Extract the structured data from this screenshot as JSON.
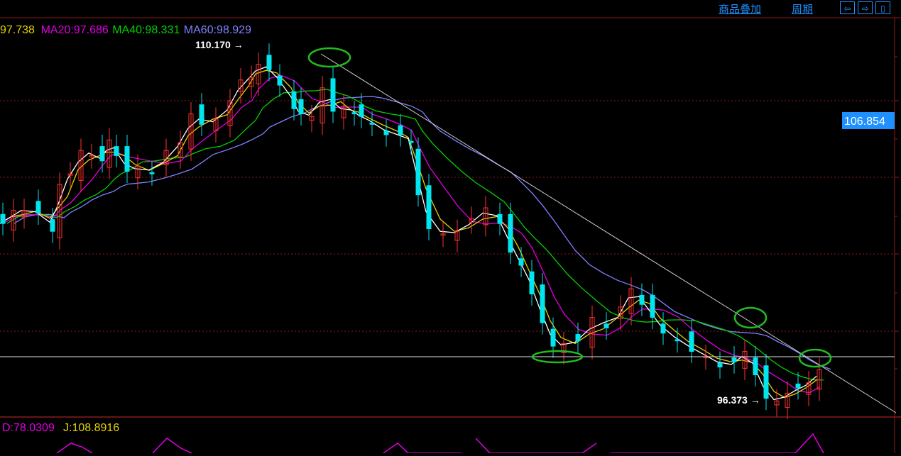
{
  "header": {
    "overlay_label": "商品叠加",
    "period_label": "周期",
    "nav_buttons": [
      "⇦",
      "⇨",
      "▯"
    ]
  },
  "ma_legend": [
    {
      "label": "97.738",
      "color": "#e6d200"
    },
    {
      "label": "MA20:97.686",
      "color": "#e000e0"
    },
    {
      "label": "MA40:98.331",
      "color": "#00d200"
    },
    {
      "label": "MA60:98.929",
      "color": "#8080ff"
    }
  ],
  "indicator_legend": [
    {
      "label": "D:78.0309",
      "color": "#e000e0"
    },
    {
      "label": "J:108.8916",
      "color": "#e6d200"
    }
  ],
  "price_tag": "106.854",
  "high_label": "110.170",
  "low_label": "96.373",
  "colors": {
    "up": "#ff3030",
    "down": "#00e5ee",
    "grid": "#8b1a1a",
    "ma_white": "#ffffff",
    "ma_yellow": "#e6d200",
    "ma_magenta": "#e000e0",
    "ma_green": "#00d200",
    "ma_purple": "#8080ff",
    "annotation": "#22bb22",
    "axis_tag_bg": "#1e90ff"
  },
  "chart_data": {
    "type": "candlestick",
    "grid": true,
    "annotations": [
      "support horizontal line",
      "descending trendline from 110.170 high",
      "4 green ellipse highlights"
    ],
    "points": [
      [
        0,
        103.4
      ],
      [
        15,
        103.9
      ],
      [
        30,
        103.9
      ],
      [
        50,
        103.8
      ],
      [
        70,
        103.1
      ],
      [
        80,
        104.9
      ],
      [
        95,
        105.3
      ],
      [
        110,
        106.2
      ],
      [
        125,
        106.0
      ],
      [
        140,
        105.8
      ],
      [
        150,
        106.6
      ],
      [
        160,
        106.0
      ],
      [
        175,
        105.4
      ],
      [
        190,
        105.6
      ],
      [
        210,
        105.3
      ],
      [
        230,
        106.2
      ],
      [
        250,
        106.5
      ],
      [
        265,
        107.6
      ],
      [
        280,
        107.2
      ],
      [
        300,
        107.4
      ],
      [
        320,
        108.1
      ],
      [
        335,
        108.9
      ],
      [
        350,
        109.0
      ],
      [
        360,
        109.5
      ],
      [
        375,
        109.3
      ],
      [
        390,
        108.7
      ],
      [
        410,
        107.8
      ],
      [
        420,
        107.6
      ],
      [
        435,
        107.5
      ],
      [
        450,
        108.6
      ],
      [
        465,
        107.7
      ],
      [
        480,
        107.9
      ],
      [
        495,
        107.6
      ],
      [
        505,
        107.5
      ],
      [
        520,
        107.2
      ],
      [
        540,
        106.8
      ],
      [
        560,
        106.8
      ],
      [
        575,
        106.5
      ],
      [
        585,
        104.5
      ],
      [
        600,
        103.2
      ],
      [
        620,
        103.0
      ],
      [
        640,
        103.1
      ],
      [
        660,
        103.6
      ],
      [
        680,
        104.0
      ],
      [
        700,
        103.4
      ],
      [
        715,
        102.3
      ],
      [
        730,
        101.8
      ],
      [
        745,
        100.7
      ],
      [
        760,
        99.6
      ],
      [
        775,
        98.7
      ],
      [
        790,
        98.8
      ],
      [
        810,
        98.9
      ],
      [
        830,
        99.8
      ],
      [
        850,
        99.4
      ],
      [
        870,
        100.2
      ],
      [
        885,
        100.9
      ],
      [
        900,
        100.3
      ],
      [
        915,
        99.8
      ],
      [
        930,
        99.2
      ],
      [
        950,
        98.9
      ],
      [
        970,
        98.5
      ],
      [
        990,
        98.3
      ],
      [
        1010,
        97.9
      ],
      [
        1030,
        98.1
      ],
      [
        1045,
        98.5
      ],
      [
        1060,
        97.6
      ],
      [
        1075,
        96.7
      ],
      [
        1090,
        96.6
      ],
      [
        1105,
        96.9
      ],
      [
        1120,
        97.1
      ],
      [
        1135,
        97.3
      ],
      [
        1150,
        97.8
      ]
    ]
  }
}
